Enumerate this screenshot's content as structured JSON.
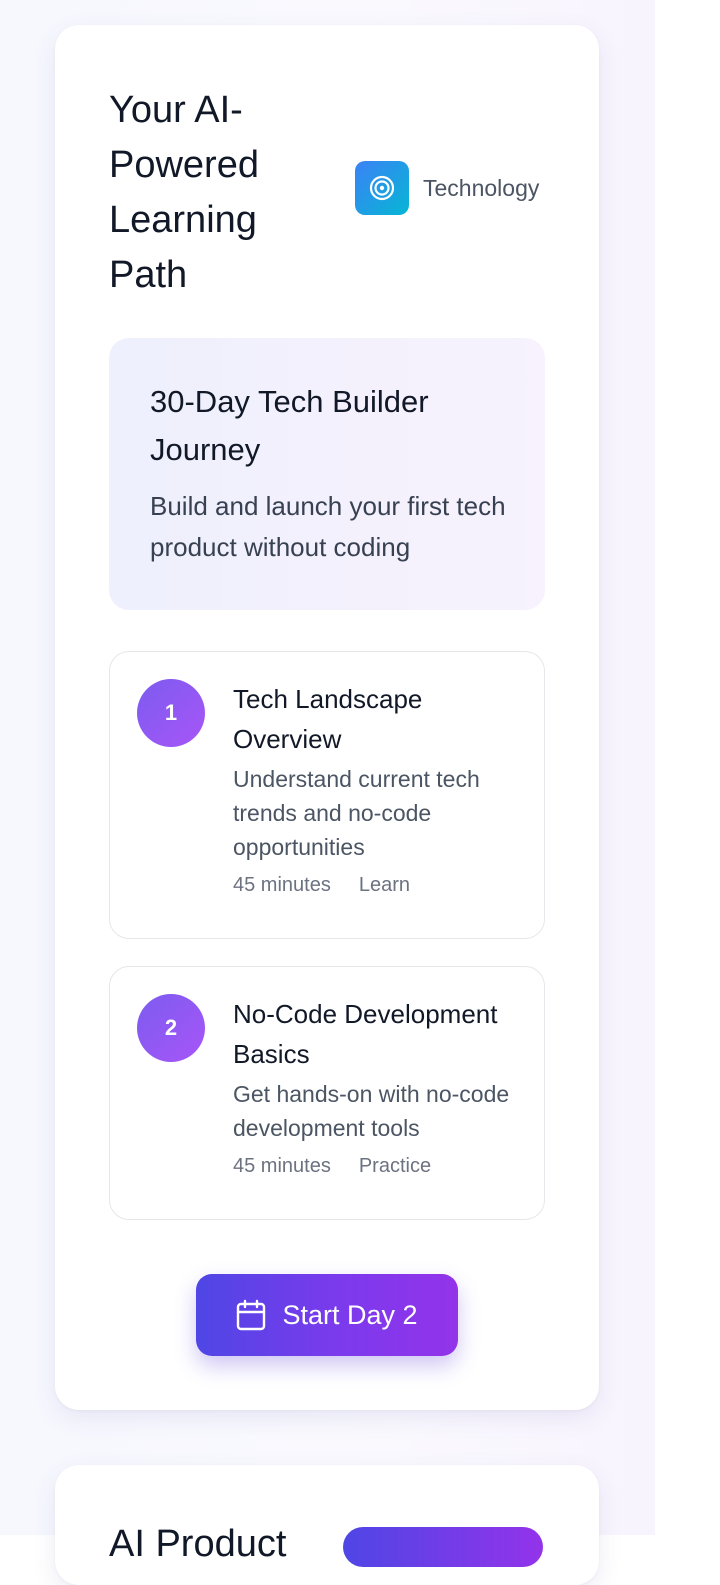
{
  "learning_path": {
    "title": "Your AI-Powered Learning Path",
    "category": {
      "icon": "target-icon",
      "label": "Technology"
    },
    "journey": {
      "title": "30-Day Tech Builder Journey",
      "description": "Build and launch your first tech product without coding"
    },
    "steps": [
      {
        "number": "1",
        "title": "Tech Landscape Overview",
        "description": "Understand current tech trends and no-code opportunities",
        "duration": "45 minutes",
        "type": "Learn"
      },
      {
        "number": "2",
        "title": "No-Code Development Basics",
        "description": "Get hands-on with no-code development tools",
        "duration": "45 minutes",
        "type": "Practice"
      }
    ],
    "cta": {
      "icon": "calendar-icon",
      "label": "Start Day 2"
    }
  },
  "next_card": {
    "title": "AI Product"
  },
  "colors": {
    "accent_start": "#4f46e5",
    "accent_end": "#9333ea",
    "category_icon_start": "#3b82f6",
    "category_icon_end": "#06b6d4"
  }
}
